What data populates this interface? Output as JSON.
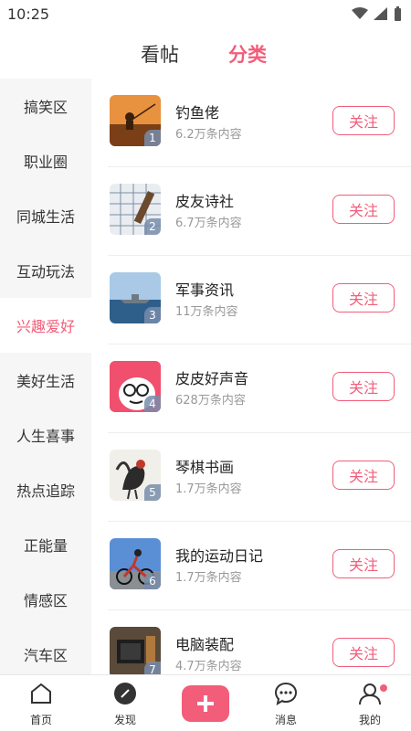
{
  "status": {
    "time": "10:25"
  },
  "tabs": [
    {
      "label": "看帖"
    },
    {
      "label": "分类"
    }
  ],
  "sidebar": {
    "items": [
      {
        "label": "搞笑区"
      },
      {
        "label": "职业圈"
      },
      {
        "label": "同城生活"
      },
      {
        "label": "互动玩法"
      },
      {
        "label": "兴趣爱好"
      },
      {
        "label": "美好生活"
      },
      {
        "label": "人生喜事"
      },
      {
        "label": "热点追踪"
      },
      {
        "label": "正能量"
      },
      {
        "label": "情感区"
      },
      {
        "label": "汽车区"
      }
    ],
    "active_index": 4
  },
  "topics": [
    {
      "title": "钓鱼佬",
      "count": "6.2万条内容",
      "rank": "1",
      "follow": "关注",
      "thumb": "fishing-icon"
    },
    {
      "title": "皮友诗社",
      "count": "6.7万条内容",
      "rank": "2",
      "follow": "关注",
      "thumb": "writing-icon"
    },
    {
      "title": "军事资讯",
      "count": "11万条内容",
      "rank": "3",
      "follow": "关注",
      "thumb": "warship-icon"
    },
    {
      "title": "皮皮好声音",
      "count": "628万条内容",
      "rank": "4",
      "follow": "关注",
      "thumb": "cartoon-face-icon"
    },
    {
      "title": "琴棋书画",
      "count": "1.7万条内容",
      "rank": "5",
      "follow": "关注",
      "thumb": "rooster-painting-icon"
    },
    {
      "title": "我的运动日记",
      "count": "1.7万条内容",
      "rank": "6",
      "follow": "关注",
      "thumb": "cyclist-icon"
    },
    {
      "title": "电脑装配",
      "count": "4.7万条内容",
      "rank": "7",
      "follow": "关注",
      "thumb": "computer-parts-icon"
    }
  ],
  "bottom_nav": [
    {
      "label": "首页",
      "icon": "home-icon"
    },
    {
      "label": "发现",
      "icon": "compass-icon"
    },
    {
      "label": "",
      "icon": "plus-icon"
    },
    {
      "label": "消息",
      "icon": "message-icon"
    },
    {
      "label": "我的",
      "icon": "profile-icon"
    }
  ],
  "colors": {
    "accent": "#f25d7a",
    "sidebar_bg": "#f6f6f6"
  }
}
